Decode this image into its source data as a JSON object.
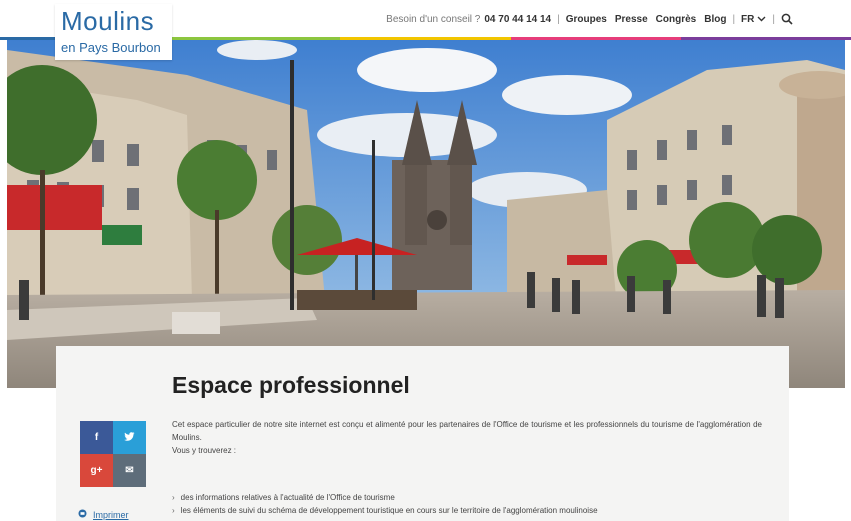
{
  "header": {
    "logo_line1": "Moulins",
    "logo_line2": "en Pays Bourbon",
    "advice_text": "Besoin d'un conseil ?",
    "phone": "04 70 44 14 14",
    "nav_items": [
      "Groupes",
      "Presse",
      "Congrès",
      "Blog"
    ],
    "language": "FR",
    "strip_colors": [
      "#2a6aa5",
      "#8cc63f",
      "#f2c500",
      "#e63d7a",
      "#7a3d9b"
    ]
  },
  "hero": {
    "icon": "cathedral-square-photo"
  },
  "content": {
    "title": "Espace professionnel",
    "intro_1": "Cet espace particulier de notre site internet est conçu et alimenté pour les partenaires de l'Office de tourisme et les professionnels du tourisme de l'agglomération de Moulins.",
    "intro_2": "Vous y trouverez :",
    "bullets": [
      "des informations relatives à l'actualité de l'Office de tourisme",
      "les éléments de suivi du schéma de développement touristique en cours sur le territoire de l'agglomération moulinoise"
    ],
    "share": {
      "facebook": "f",
      "twitter": "t",
      "googleplus": "g+",
      "mail": "✉"
    },
    "print_label": "Imprimer"
  }
}
